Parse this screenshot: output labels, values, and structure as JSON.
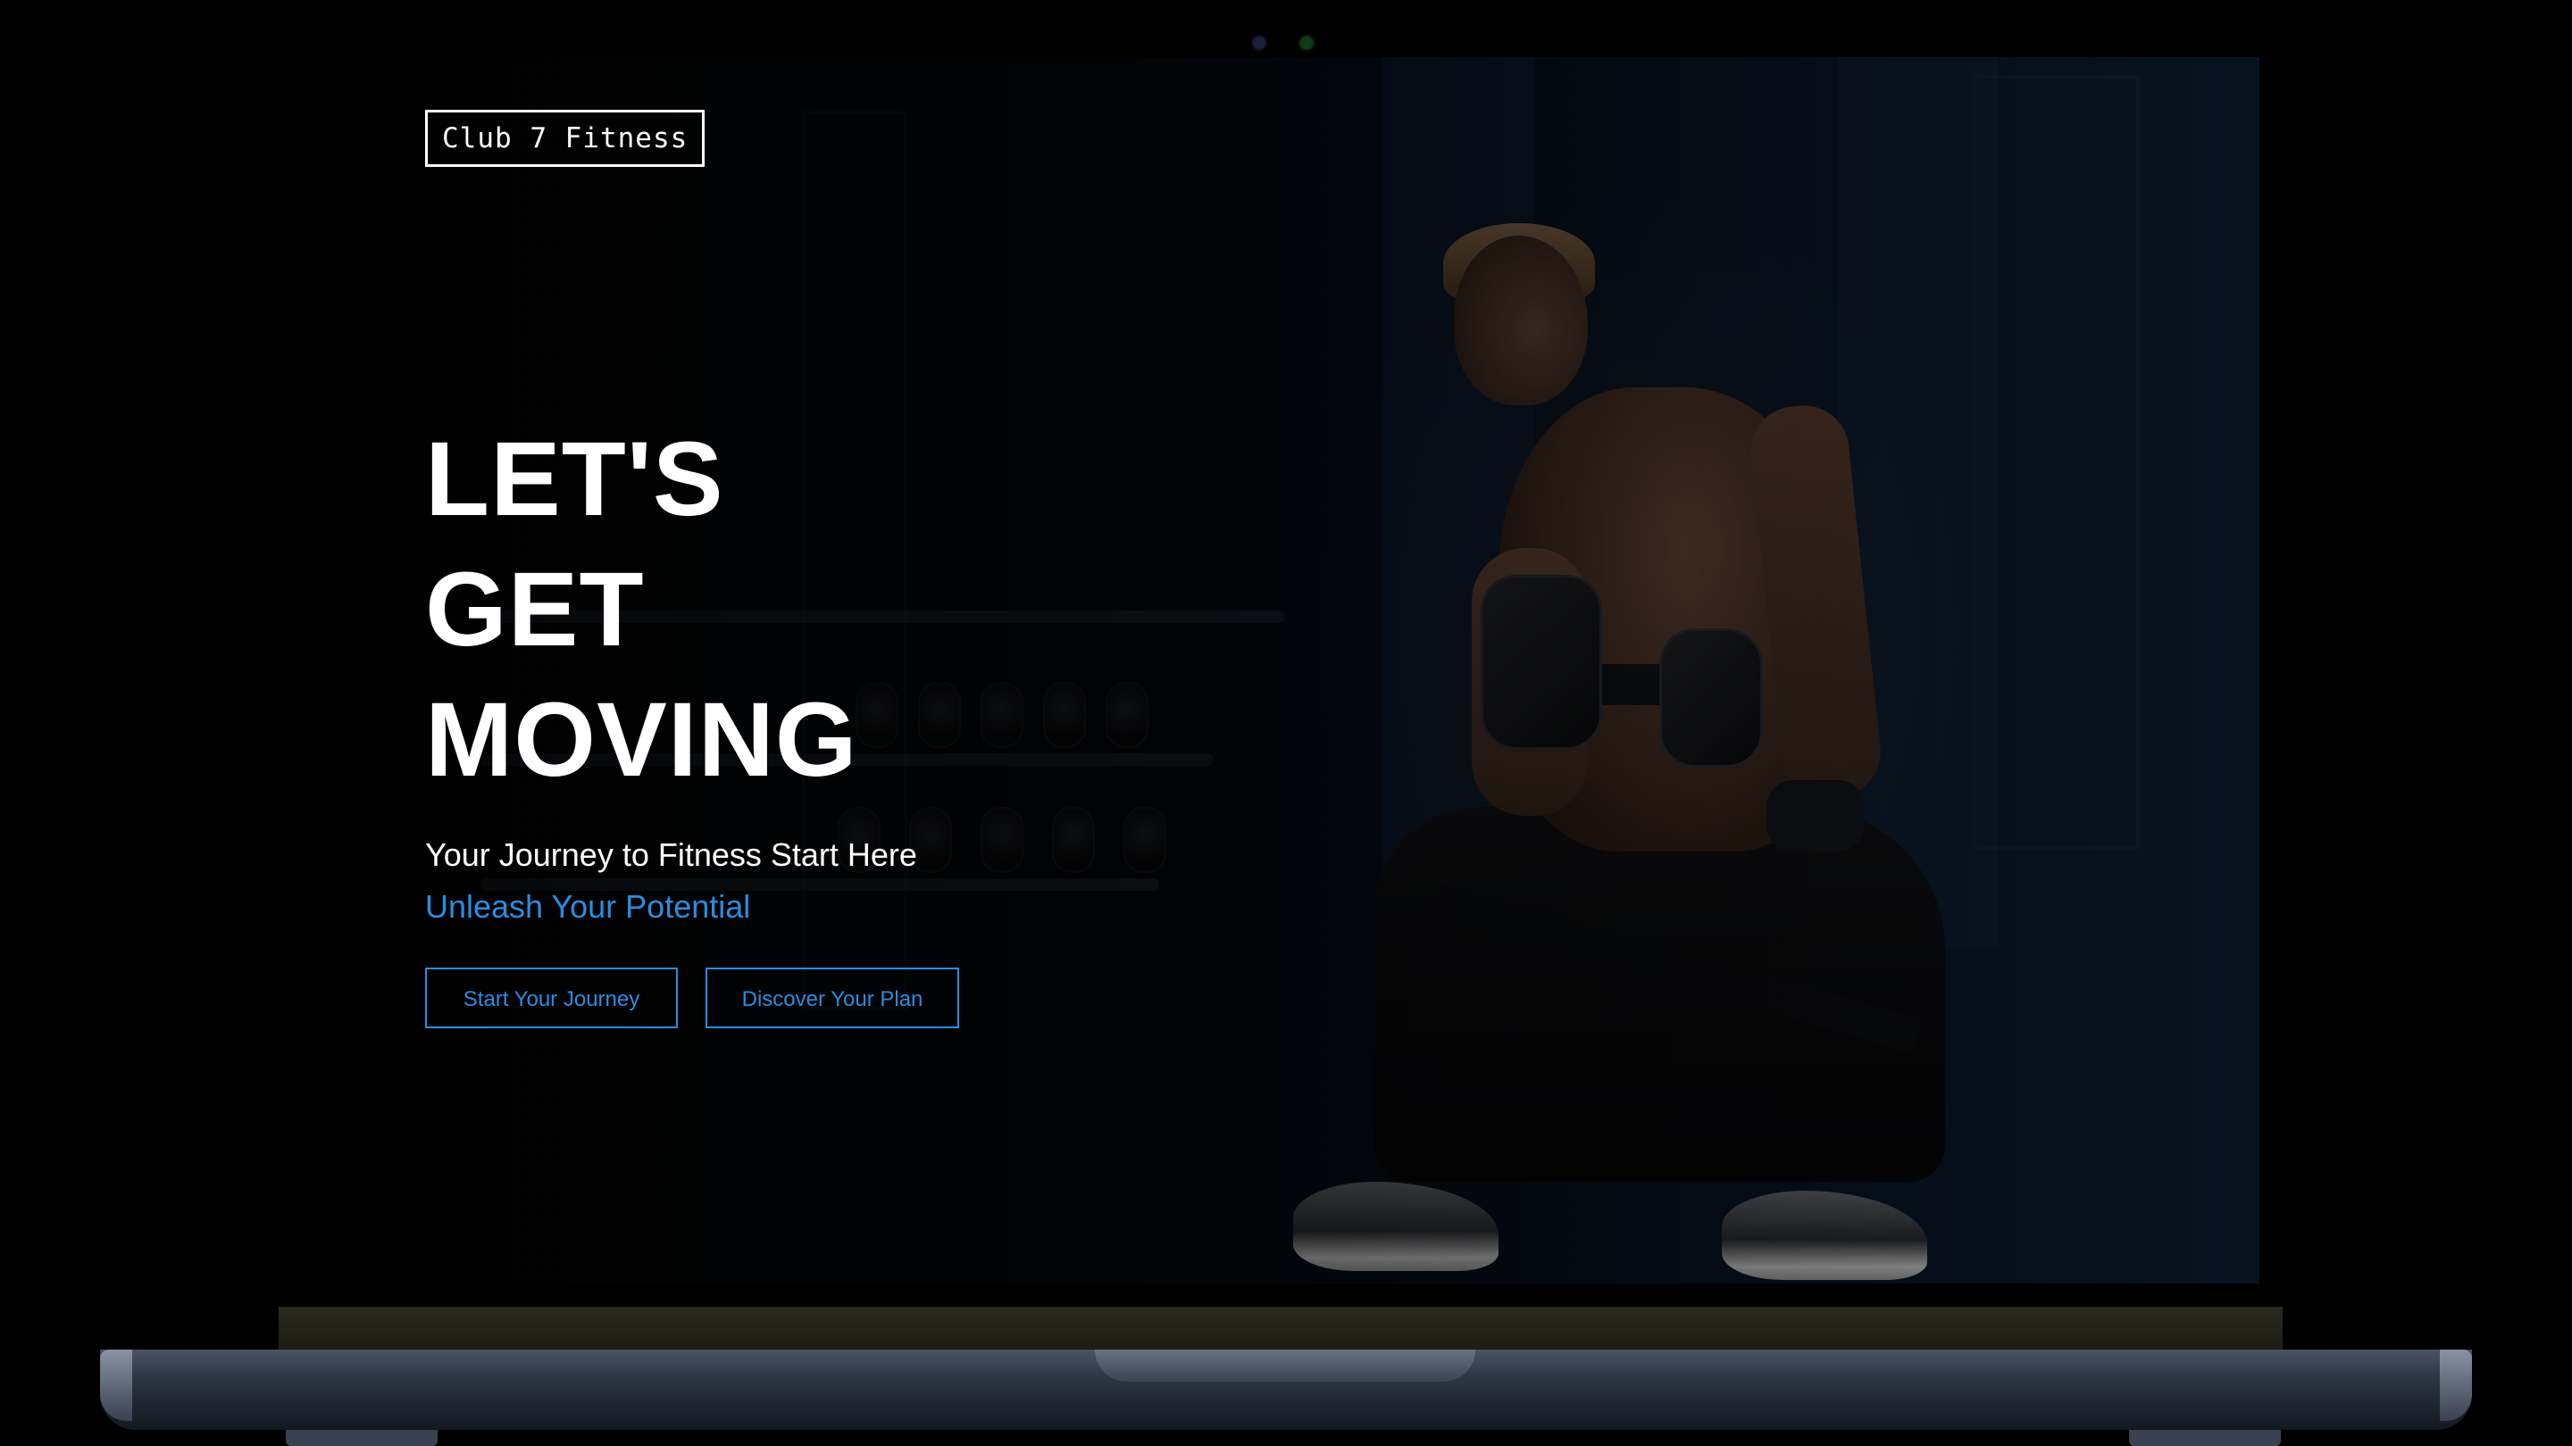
{
  "brand": {
    "logo_text": "Club 7 Fitness"
  },
  "hero": {
    "headline_lines": [
      "LET'S",
      "GET",
      "MOVING"
    ],
    "tagline": "Your Journey to Fitness Start Here",
    "subtagline": "Unleash Your Potential"
  },
  "actions": {
    "primary_label": "Start Your Journey",
    "secondary_label": "Discover Your Plan"
  },
  "colors": {
    "accent": "#2a8de0",
    "text": "#ffffff",
    "background": "#000000"
  },
  "icons": {
    "background_image": "athlete-dumbbell-photo"
  }
}
